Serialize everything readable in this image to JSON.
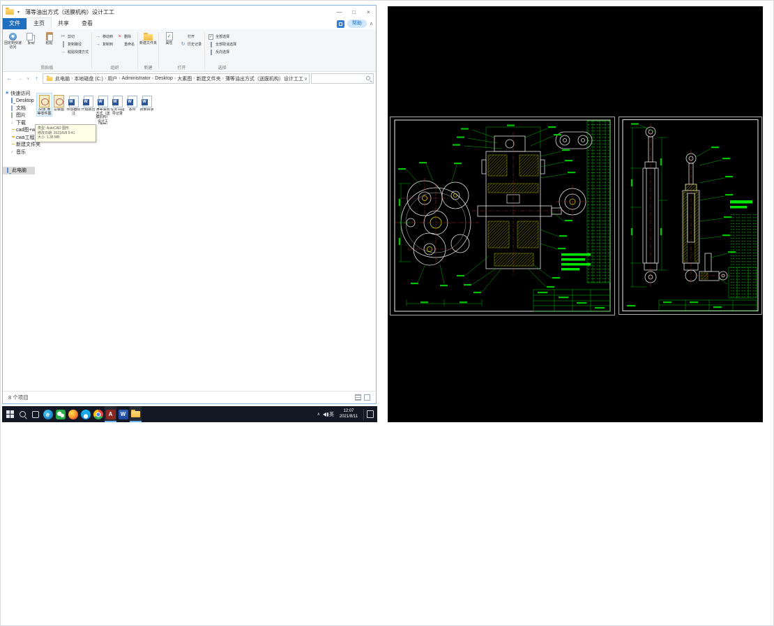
{
  "colors": {
    "accent_blue": "#2b88d8",
    "file_tab_blue": "#1f6fc0",
    "taskbar_bg": "#141824",
    "selection_gray": "#d9d9d9",
    "cad_background": "#000000",
    "cad_outline_white": "#e2e2e2",
    "cad_dimension_green": "#00c300",
    "cad_bright_green": "#00e400",
    "cad_hatch_yellow": "#c8c800",
    "cad_centerline_red": "#c23b3b"
  },
  "titlebar": {
    "app_title": "薄等油出方式（送膜机构）设计工工",
    "qat_chevron": "▾",
    "minimize": "—",
    "maximize": "□",
    "close": "×"
  },
  "menubar": {
    "tab_file": "文件",
    "tab_home": "主页",
    "tab_share": "共享",
    "tab_view": "查看",
    "help_pill": "帮助",
    "collapse": "∧"
  },
  "ribbon": {
    "pin": "固定到快速访问",
    "copy": "复制",
    "paste": "粘贴",
    "cut": "剪切",
    "copy_path": "复制路径",
    "paste_shortcut": "粘贴快捷方式",
    "move_to": "移动到",
    "copy_to": "复制到",
    "delete": "删除",
    "rename": "重命名",
    "new_folder": "新建文件夹",
    "properties": "属性",
    "open": "打开",
    "history": "历史记录",
    "select_all": "全部选择",
    "select_none": "全部取消选择",
    "invert_selection": "反向选择",
    "group_clipboard": "剪贴板",
    "group_organize": "组织",
    "group_new": "新建",
    "group_open": "打开",
    "group_select": "选择"
  },
  "addressbar": {
    "back": "←",
    "forward": "→",
    "up": "↑",
    "history_chevron": "∨",
    "sep": "›",
    "crumbs": [
      "此电脑",
      "本地磁盘 (C:)",
      "用户",
      "Administrator",
      "Desktop",
      "大素图",
      "新建文件夹",
      "薄等油出方式（送膜机构）设计工工"
    ],
    "dropdown": "∨",
    "refresh": "↻"
  },
  "sidebar": {
    "quick_access": "快速访问",
    "items": [
      {
        "label": "Desktop"
      },
      {
        "label": "文档"
      },
      {
        "label": "图片"
      },
      {
        "label": "下载"
      },
      {
        "label": "cad图+wd图"
      },
      {
        "label": "cwa工程图"
      },
      {
        "label": "新建文件夹"
      },
      {
        "label": "音乐"
      },
      {
        "label": "此电脑"
      }
    ]
  },
  "files": {
    "items": [
      {
        "name": "32张 薄等零件图",
        "type": "dwg"
      },
      {
        "name": "总装图",
        "type": "dwg"
      },
      {
        "name": "传感器标注",
        "type": "doc"
      },
      {
        "name": "开题报告",
        "type": "doc"
      },
      {
        "name": "薄等油出方式（送膜机构）设计工（薄箱）",
        "type": "doc"
      },
      {
        "name": "任务书指导记录",
        "type": "doc"
      },
      {
        "name": "答辩",
        "type": "doc"
      },
      {
        "name": "搜索目录",
        "type": "doc"
      }
    ],
    "tooltip_line1": "类型: AutoCAD 图形",
    "tooltip_line2": "修改日期: 2021/6/8 9:41",
    "tooltip_line3": "大小: 1.35 MB"
  },
  "statusbar": {
    "item_count": "8 个项目"
  },
  "taskbar": {
    "tray_chevron": "∧",
    "ime": "英",
    "time": "12:07",
    "date": "2021/8/11"
  },
  "icons": {
    "scissors": "✂",
    "arrow_right": "→",
    "close_x": "×",
    "check": "✓",
    "refresh": "↻",
    "star": "★",
    "download_arrow": "↓",
    "music_note": "♪",
    "word_w": "W",
    "autocad_a": "A",
    "edge_e": "e"
  },
  "cad": {
    "sheet_count": 2,
    "background": "#000000"
  }
}
